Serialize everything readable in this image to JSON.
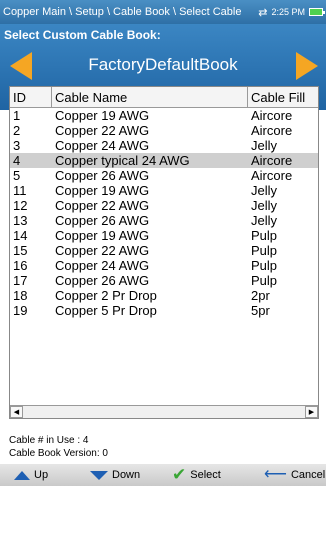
{
  "titlebar": {
    "breadcrumb": "Copper Main \\ Setup \\ Cable Book \\ Select Cable",
    "sync_symbol": "⇄",
    "time": "2:25 PM"
  },
  "header": {
    "section_label": "Select Custom Cable Book:",
    "book_name": "FactoryDefaultBook"
  },
  "table": {
    "columns": [
      "ID",
      "Cable Name",
      "Cable Fill"
    ],
    "rows": [
      {
        "id": "1",
        "name": "Copper 19 AWG",
        "fill": "Aircore"
      },
      {
        "id": "2",
        "name": "Copper 22 AWG",
        "fill": "Aircore"
      },
      {
        "id": "3",
        "name": "Copper 24 AWG",
        "fill": "Jelly"
      },
      {
        "id": "4",
        "name": "Copper typical 24 AWG",
        "fill": "Aircore"
      },
      {
        "id": "5",
        "name": "Copper 26 AWG",
        "fill": "Aircore"
      },
      {
        "id": "11",
        "name": "Copper 19 AWG",
        "fill": "Jelly"
      },
      {
        "id": "12",
        "name": "Copper 22 AWG",
        "fill": "Jelly"
      },
      {
        "id": "13",
        "name": "Copper 26 AWG",
        "fill": "Jelly"
      },
      {
        "id": "14",
        "name": "Copper 19 AWG",
        "fill": "Pulp"
      },
      {
        "id": "15",
        "name": "Copper 22 AWG",
        "fill": "Pulp"
      },
      {
        "id": "16",
        "name": "Copper 24 AWG",
        "fill": "Pulp"
      },
      {
        "id": "17",
        "name": "Copper 26 AWG",
        "fill": "Pulp"
      },
      {
        "id": "18",
        "name": "Copper 2 Pr Drop",
        "fill": "2pr"
      },
      {
        "id": "19",
        "name": "Copper 5 Pr Drop",
        "fill": "5pr"
      }
    ]
  },
  "info": {
    "cable_in_use": "Cable # in Use : 4",
    "book_version": "Cable Book Version: 0"
  },
  "toolbar": {
    "up_label": "Up",
    "down_label": "Down",
    "select_label": "Select",
    "cancel_label": "Cancel"
  },
  "colors": {
    "header_blue": "#2e6fa6",
    "arrow_orange": "#f5a623",
    "selected_row": "#cfcfcf",
    "select_check_green": "#3aa635",
    "toolbar_blue": "#1e5fb3"
  }
}
